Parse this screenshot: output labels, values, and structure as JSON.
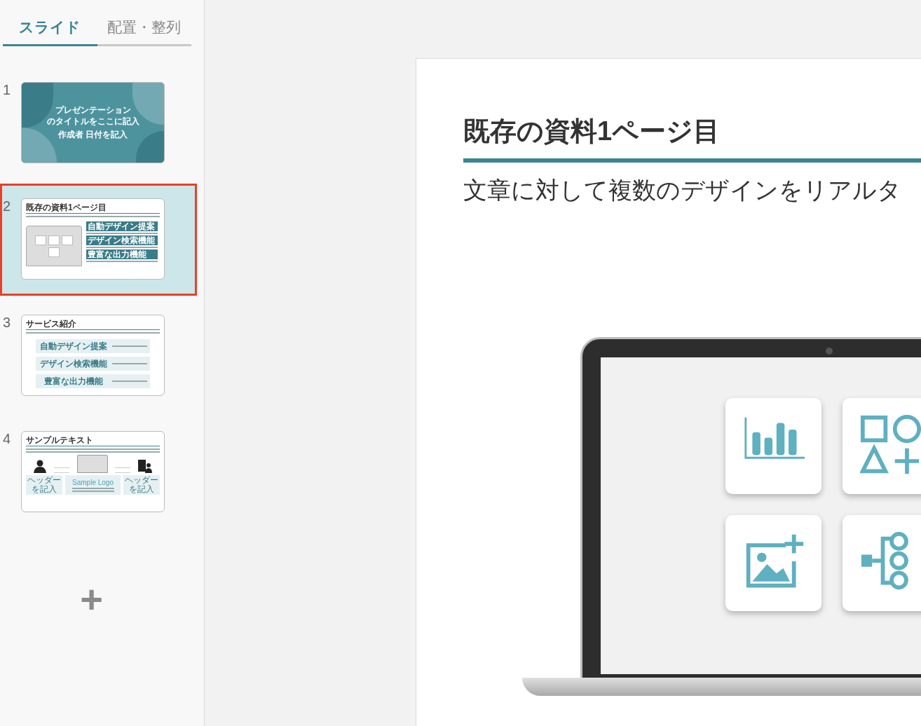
{
  "tabs": [
    {
      "label": "スライド",
      "selected": true
    },
    {
      "label": "配置・整列",
      "selected": false
    }
  ],
  "slides": [
    {
      "number": "1",
      "selected": false,
      "kind": "cover",
      "title_lines": [
        "プレゼンテーション",
        "のタイトルをここに記入"
      ],
      "subtitle": "作成者 日付を記入"
    },
    {
      "number": "2",
      "selected": true,
      "kind": "laptop",
      "title": "既存の資料1ページ目",
      "features": [
        "自動デザイン提案",
        "デザイン検索機能",
        "豊富な出力機能"
      ]
    },
    {
      "number": "3",
      "selected": false,
      "kind": "list",
      "title": "サービス紹介",
      "features": [
        "自動デザイン提案",
        "デザイン検索機能",
        "豊富な出力機能"
      ]
    },
    {
      "number": "4",
      "selected": false,
      "kind": "flow",
      "title": "サンプルテキスト",
      "headers": [
        "ヘッダーを記入",
        "ヘッダーを記入"
      ],
      "logo": "Sample Logo"
    }
  ],
  "add_button": {
    "label": "+"
  },
  "editor": {
    "title": "既存の資料1ページ目",
    "text": "文章に対して複数のデザインをリアルタ"
  }
}
